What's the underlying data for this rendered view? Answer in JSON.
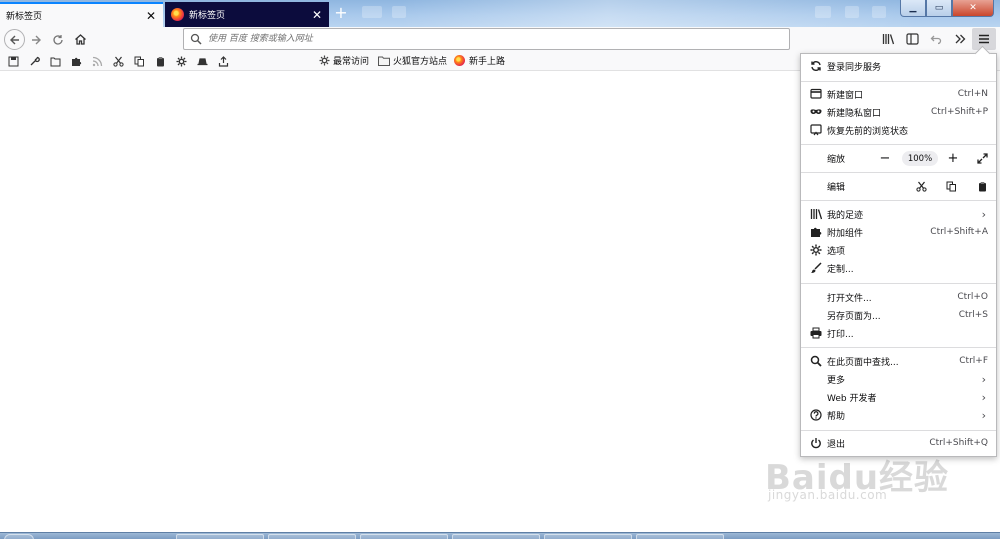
{
  "tabs": [
    {
      "label": "新标签页",
      "active": true
    },
    {
      "label": "新标签页",
      "active": false
    }
  ],
  "navbar": {
    "url_placeholder": "使用 百度 搜索或输入网址"
  },
  "bookmarks": [
    {
      "label": "最常访问",
      "icon": "gear-icon"
    },
    {
      "label": "火狐官方站点",
      "icon": "folder-icon"
    },
    {
      "label": "新手上路",
      "icon": "firefox-icon"
    }
  ],
  "menu": {
    "sync": {
      "label": "登录同步服务"
    },
    "new_window": {
      "label": "新建窗口",
      "shortcut": "Ctrl+N"
    },
    "private_window": {
      "label": "新建隐私窗口",
      "shortcut": "Ctrl+Shift+P"
    },
    "restore": {
      "label": "恢复先前的浏览状态"
    },
    "zoom": {
      "label": "缩放",
      "value": "100%"
    },
    "edit": {
      "label": "编辑"
    },
    "library": {
      "label": "我的足迹"
    },
    "addons": {
      "label": "附加组件",
      "shortcut": "Ctrl+Shift+A"
    },
    "options": {
      "label": "选项"
    },
    "customize": {
      "label": "定制..."
    },
    "open_file": {
      "label": "打开文件...",
      "shortcut": "Ctrl+O"
    },
    "save_as": {
      "label": "另存页面为...",
      "shortcut": "Ctrl+S"
    },
    "print": {
      "label": "打印..."
    },
    "find": {
      "label": "在此页面中查找...",
      "shortcut": "Ctrl+F"
    },
    "more": {
      "label": "更多"
    },
    "webdev": {
      "label": "Web 开发者"
    },
    "help": {
      "label": "帮助"
    },
    "quit": {
      "label": "退出",
      "shortcut": "Ctrl+Shift+Q"
    }
  },
  "watermark": {
    "logo": "Baidu经验",
    "url": "jingyan.baidu.com"
  },
  "colors": {
    "accent": "#0a84ff",
    "inactive_tab": "#0c0c3d",
    "toolbar": "#f9f9fa"
  }
}
